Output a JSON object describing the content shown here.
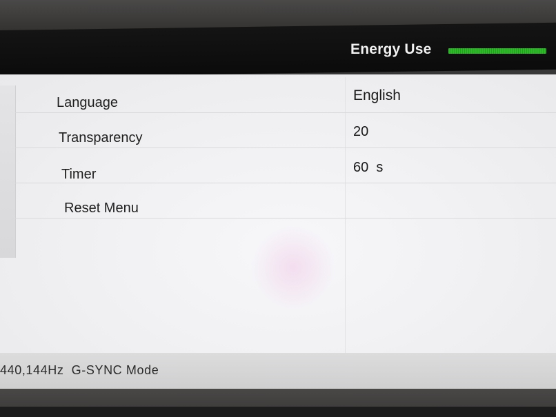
{
  "header": {
    "energy_label": "Energy Use",
    "energy_level": 1.0,
    "energy_color": "#2fb82a"
  },
  "menu": {
    "items": [
      {
        "label": "Language",
        "value": "English"
      },
      {
        "label": "Transparency",
        "value": "20"
      },
      {
        "label": "Timer",
        "value": "60  s"
      },
      {
        "label": "Reset Menu",
        "value": ""
      }
    ]
  },
  "footer": {
    "status": "440,144Hz  G-SYNC Mode"
  }
}
